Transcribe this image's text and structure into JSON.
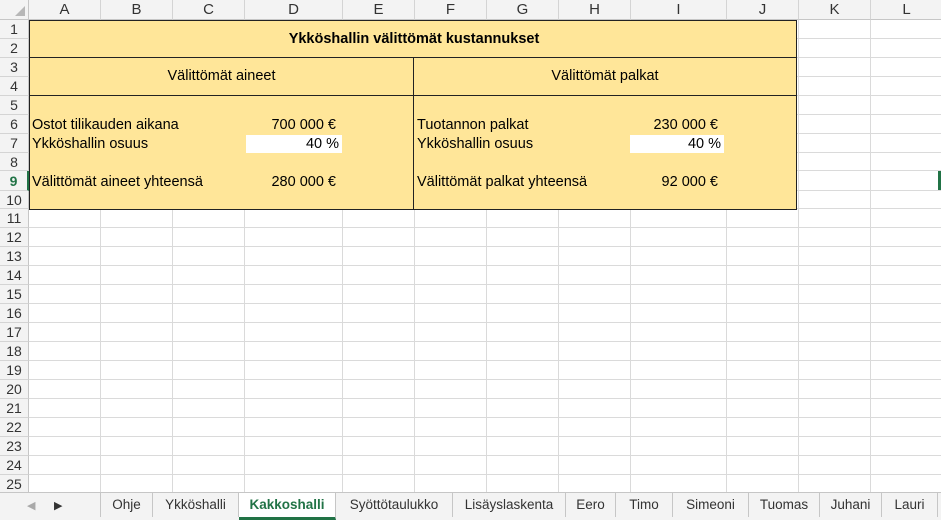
{
  "columns": [
    "A",
    "B",
    "C",
    "D",
    "E",
    "F",
    "G",
    "H",
    "I",
    "J",
    "K",
    "L"
  ],
  "rows": [
    "1",
    "2",
    "3",
    "4",
    "5",
    "6",
    "7",
    "8",
    "9",
    "10",
    "11",
    "12",
    "13",
    "14",
    "15",
    "16",
    "17",
    "18",
    "19",
    "20",
    "21",
    "22",
    "23",
    "24",
    "25"
  ],
  "active_row": "9",
  "sheet": {
    "title": "Ykköshallin välittömät kustannukset",
    "left": {
      "heading": "Välittömät aineet",
      "row6_label": "Ostot tilikauden aikana",
      "row6_value": "700 000 €",
      "row7_label": "Ykköshallin osuus",
      "row7_value": "40 %",
      "row9_label": "Välittömät aineet yhteensä",
      "row9_value": "280 000 €"
    },
    "right": {
      "heading": "Välittömät palkat",
      "row6_label": "Tuotannon palkat",
      "row6_value": "230 000 €",
      "row7_label": "Ykköshallin osuus",
      "row7_value": "40 %",
      "row9_label": "Välittömät palkat yhteensä",
      "row9_value": "92 000 €"
    }
  },
  "tabs": [
    {
      "label": "Ohje",
      "active": false
    },
    {
      "label": "Ykköshalli",
      "active": false
    },
    {
      "label": "Kakkoshalli",
      "active": true
    },
    {
      "label": "Syöttötaulukko",
      "active": false
    },
    {
      "label": "Lisäyslaskenta",
      "active": false
    },
    {
      "label": "Eero",
      "active": false
    },
    {
      "label": "Timo",
      "active": false
    },
    {
      "label": "Simeoni",
      "active": false
    },
    {
      "label": "Tuomas",
      "active": false
    },
    {
      "label": "Juhani",
      "active": false
    },
    {
      "label": "Lauri",
      "active": false
    }
  ],
  "icons": {
    "prev_sheet": "triangle-left",
    "next_sheet": "triangle-right"
  },
  "colors": {
    "fill": "#ffe699",
    "accent": "#217346"
  }
}
